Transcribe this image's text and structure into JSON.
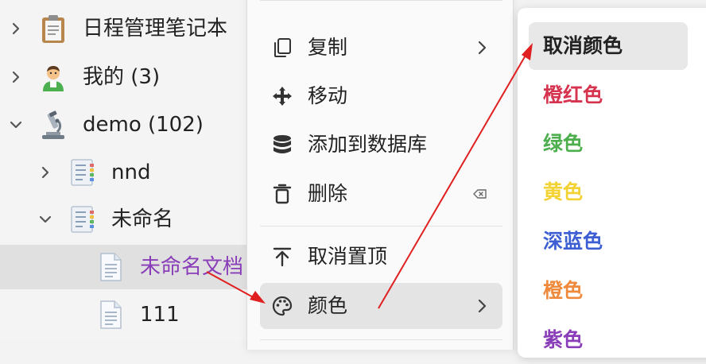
{
  "tree": {
    "items": [
      {
        "label": "日程管理笔记本",
        "icon": "clipboard-icon"
      },
      {
        "label": "我的 (3)",
        "icon": "user-avatar-icon"
      },
      {
        "label": "demo (102)",
        "icon": "microscope-icon"
      },
      {
        "label": "nnd",
        "icon": "document-icon"
      },
      {
        "label": "未命名",
        "icon": "document-icon"
      },
      {
        "label": "未命名文档",
        "icon": "file-icon",
        "color": "#8a3db8"
      },
      {
        "label": "111",
        "icon": "file-icon"
      }
    ]
  },
  "menu": {
    "items": [
      {
        "label": "复制",
        "icon": "copy-icon",
        "submenu": true
      },
      {
        "label": "移动",
        "icon": "move-icon"
      },
      {
        "label": "添加到数据库",
        "icon": "database-icon"
      },
      {
        "label": "删除",
        "icon": "trash-icon",
        "shortcut_icon": "delete-key-icon"
      },
      {
        "label": "取消置顶",
        "icon": "unpin-top-icon"
      },
      {
        "label": "颜色",
        "icon": "palette-icon",
        "submenu": true
      }
    ]
  },
  "color_submenu": {
    "items": [
      {
        "label": "取消颜色",
        "color": "#222222"
      },
      {
        "label": "橙红色",
        "color": "#d6334f"
      },
      {
        "label": "绿色",
        "color": "#4cae4c"
      },
      {
        "label": "黄色",
        "color": "#f3d234"
      },
      {
        "label": "深蓝色",
        "color": "#3d5fd3"
      },
      {
        "label": "橙色",
        "color": "#ef8a3c"
      },
      {
        "label": "紫色",
        "color": "#8a3db8"
      }
    ]
  },
  "colors": {
    "annotation_arrow": "#e02020",
    "selected_row": "#e0e0e0",
    "hover_item": "#e4e4e4"
  }
}
